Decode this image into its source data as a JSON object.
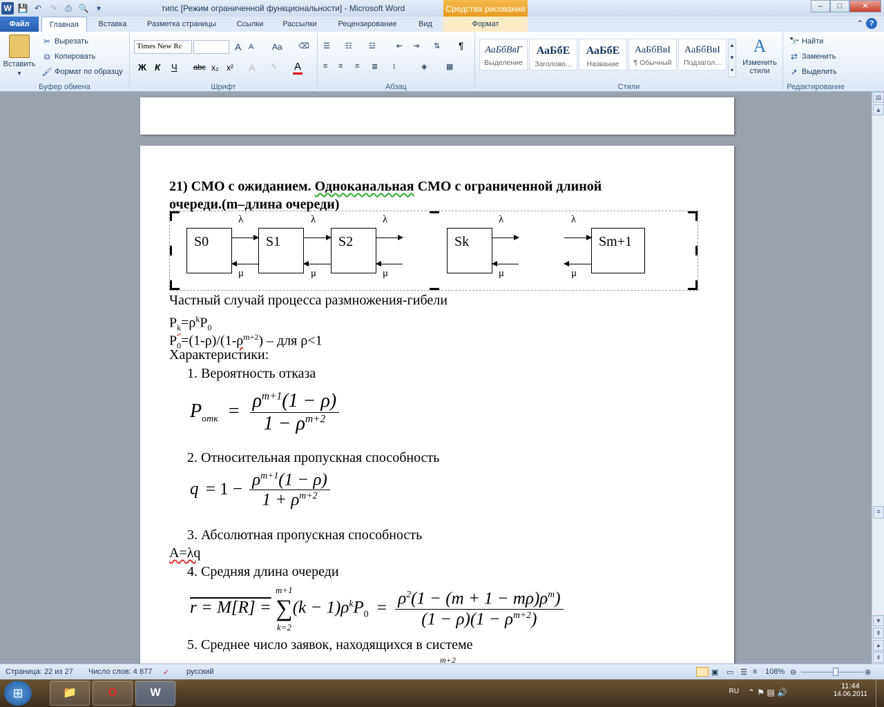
{
  "window": {
    "title": "типс [Режим ограниченной функциональности]  -  Microsoft Word",
    "context_title": "Средства рисования",
    "app_icon": "W",
    "controls": [
      "–",
      "□",
      "✕"
    ]
  },
  "tabs": {
    "file": "Файл",
    "home": "Главная",
    "insert": "Вставка",
    "layout": "Разметка страницы",
    "refs": "Ссылки",
    "mailings": "Рассылки",
    "review": "Рецензирование",
    "view": "Вид",
    "format": "Формат"
  },
  "ribbon": {
    "clipboard": {
      "label": "Буфер обмена",
      "paste": "Вставить",
      "cut": "Вырезать",
      "copy": "Копировать",
      "format_painter": "Формат по образцу"
    },
    "font": {
      "label": "Шрифт",
      "family": "Times New Rc",
      "size": "",
      "bold": "Ж",
      "italic": "К",
      "underline": "Ч",
      "strike": "abc",
      "sub": "x₂",
      "sup": "x²",
      "grow": "A",
      "shrink": "A",
      "case": "Aa",
      "color_letter": "А"
    },
    "paragraph": {
      "label": "Абзац",
      "pilcrow": "¶"
    },
    "styles": {
      "label": "Стили",
      "items": [
        {
          "sample": "АаБбВвГ",
          "name": "Выделение"
        },
        {
          "sample": "АаБбЕ",
          "name": "Заголово..."
        },
        {
          "sample": "АаБбЕ",
          "name": "Название"
        },
        {
          "sample": "АаБбВвІ",
          "name": "¶ Обычный"
        },
        {
          "sample": "АаБбВвІ",
          "name": "Подзагол..."
        }
      ],
      "change": "Изменить стили"
    },
    "editing": {
      "label": "Редактирование",
      "find": "Найти",
      "replace": "Заменить",
      "select": "Выделить"
    }
  },
  "document": {
    "heading_line1_a": "21) СМО с ожиданием. ",
    "heading_line1_b": "Одноканальная",
    "heading_line1_c": " СМО с ограниченной длиной",
    "heading_line2": "очереди.(m–длина очереди)",
    "diagram": {
      "states": [
        "S0",
        "S1",
        "S2",
        "Sk",
        "Sm+1"
      ],
      "lambda": "λ",
      "mu": "μ"
    },
    "line1": "Частный случай процесса размножения-гибели",
    "pk": {
      "P": "P",
      "k": "k",
      "eq": "=ρ",
      "kexp": "k",
      "P0": "P",
      "zero": "0"
    },
    "p0": {
      "P": "P",
      "zero": "0",
      "rest_a": "=(1-ρ)/(1-",
      "rho": "ρ",
      "exp": "m+2",
      "rest_b": ") – для ρ<1"
    },
    "characteristics": "Характеристики:",
    "items": [
      "1. Вероятность отказа",
      "2. Относительная пропускная способность",
      "3. Абсолютная пропускная способность",
      "4. Средняя длина очереди",
      "5. Среднее число заявок, находящихся в системе"
    ],
    "a_formula": "A=λq",
    "f1": {
      "P": "P",
      "sub": "отк",
      "eq": "=",
      "num_rho": "ρ",
      "num_exp": "m+1",
      "num_rest": "(1 − ρ)",
      "den_one": "1 − ρ",
      "den_exp": "m+2"
    },
    "f2": {
      "q": "q",
      "eq": "= 1 −",
      "num_rho": "ρ",
      "num_exp": "m+1",
      "num_rest": "(1 − ρ)",
      "den": "1 + ρ",
      "den_exp": "m+2"
    },
    "f4": {
      "lhs": "r = M[R] =",
      "sum_top": "m+1",
      "sum": "∑",
      "sum_bot": "k=2",
      "term": "(k − 1)ρ",
      "kexp": "k",
      "P0": "P",
      "zero": "0",
      "eq": "=",
      "num": "ρ",
      "num_exp2": "2",
      "num_rest": "(1 − (m + 1 − mρ)ρ",
      "num_m": "m",
      "num_end": ")",
      "den": "(1 − ρ)(1 − ρ",
      "den_exp": "m+2",
      "den_end": ")"
    },
    "cut_exp": "m+2"
  },
  "status": {
    "page": "Страница: 22 из 27",
    "words": "Число слов: 4 877",
    "lang": "русский",
    "zoom": "108%"
  },
  "taskbar": {
    "lang": "RU",
    "time": "11:44",
    "date": "14.06.2011"
  }
}
